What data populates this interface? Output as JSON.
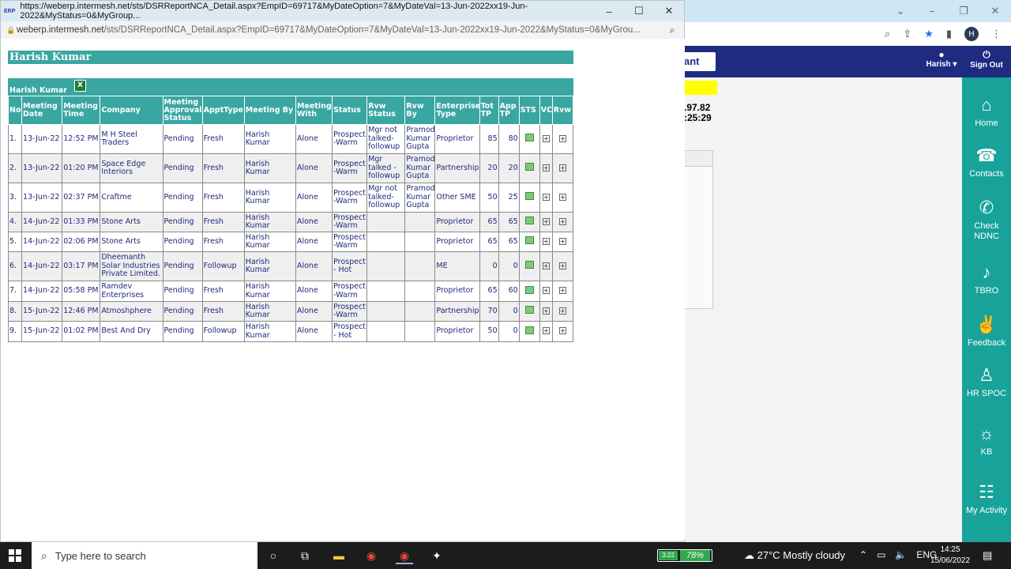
{
  "popup": {
    "title": "https://weberp.intermesh.net/sts/DSRReportNCA_Detail.aspx?EmpID=69717&MyDateOption=7&MyDateVal=13-Jun-2022xx19-Jun-2022&MyStatus=0&MyGroup...",
    "url_domain": "weberp.intermesh.net",
    "url_path": "/sts/DSRReportNCA_Detail.aspx?EmpID=69717&MyDateOption=7&MyDateVal=13-Jun-2022xx19-Jun-2022&MyStatus=0&MyGrou...",
    "logo_text": "ERP"
  },
  "report": {
    "header": "Harish Kumar",
    "subheader": "Harish Kumar",
    "columns": [
      "No",
      "Meeting Date",
      "Meeting Time",
      "Company",
      "Meeting Approval Status",
      "ApptType",
      "Meeting By",
      "Meeting With",
      "Status",
      "Rvw Status",
      "Rvw By",
      "Enterprise Type",
      "Tot TP",
      "App TP",
      "STS",
      "VC",
      "Rvw"
    ],
    "rows": [
      {
        "no": "1.",
        "date": "13-Jun-22",
        "time": "12:52 PM",
        "company": "M H Steel Traders",
        "approval": "Pending",
        "appt": "Fresh",
        "by": "Harish Kumar",
        "with": "Alone",
        "status": "Prospect -Warm",
        "rvw_status": "Mgr not talked-followup",
        "rvw_by": "Pramod Kumar Gupta",
        "ent": "Proprietor",
        "tot": "85",
        "app": "80"
      },
      {
        "no": "2.",
        "date": "13-Jun-22",
        "time": "01:20 PM",
        "company": "Space Edge Interiors",
        "approval": "Pending",
        "appt": "Fresh",
        "by": "Harish Kumar",
        "with": "Alone",
        "status": "Prospect -Warm",
        "rvw_status": "Mgr talked - followup",
        "rvw_by": "Pramod Kumar Gupta",
        "ent": "Partnership",
        "tot": "20",
        "app": "20"
      },
      {
        "no": "3.",
        "date": "13-Jun-22",
        "time": "02:37 PM",
        "company": "Craftme",
        "approval": "Pending",
        "appt": "Fresh",
        "by": "Harish Kumar",
        "with": "Alone",
        "status": "Prospect -Warm",
        "rvw_status": "Mgr not talked-followup",
        "rvw_by": "Pramod Kumar Gupta",
        "ent": "Other SME",
        "tot": "50",
        "app": "25"
      },
      {
        "no": "4.",
        "date": "14-Jun-22",
        "time": "01:33 PM",
        "company": "Stone Arts",
        "approval": "Pending",
        "appt": "Fresh",
        "by": "Harish Kumar",
        "with": "Alone",
        "status": "Prospect -Warm",
        "rvw_status": "",
        "rvw_by": "",
        "ent": "Proprietor",
        "tot": "65",
        "app": "65"
      },
      {
        "no": "5.",
        "date": "14-Jun-22",
        "time": "02:06 PM",
        "company": "Stone Arts",
        "approval": "Pending",
        "appt": "Fresh",
        "by": "Harish Kumar",
        "with": "Alone",
        "status": "Prospect -Warm",
        "rvw_status": "",
        "rvw_by": "",
        "ent": "Proprietor",
        "tot": "65",
        "app": "65"
      },
      {
        "no": "6.",
        "date": "14-Jun-22",
        "time": "03:17 PM",
        "company": "Dheemanth Solar Industries Private Limited.",
        "approval": "Pending",
        "appt": "Followup",
        "by": "Harish Kumar",
        "with": "Alone",
        "status": "Prospect - Hot",
        "rvw_status": "",
        "rvw_by": "",
        "ent": "ME",
        "tot": "0",
        "app": "0"
      },
      {
        "no": "7.",
        "date": "14-Jun-22",
        "time": "05:58 PM",
        "company": "Ramdev Enterprises",
        "approval": "Pending",
        "appt": "Fresh",
        "by": "Harish Kumar",
        "with": "Alone",
        "status": "Prospect -Warm",
        "rvw_status": "",
        "rvw_by": "",
        "ent": "Proprietor",
        "tot": "65",
        "app": "60"
      },
      {
        "no": "8.",
        "date": "15-Jun-22",
        "time": "12:46 PM",
        "company": "Atmoshphere",
        "approval": "Pending",
        "appt": "Fresh",
        "by": "Harish Kumar",
        "with": "Alone",
        "status": "Prospect -Warm",
        "rvw_status": "",
        "rvw_by": "",
        "ent": "Partnership",
        "tot": "70",
        "app": "0"
      },
      {
        "no": "9.",
        "date": "15-Jun-22",
        "time": "01:02 PM",
        "company": "Best And Dry",
        "approval": "Pending",
        "appt": "Followup",
        "by": "Harish Kumar",
        "with": "Alone",
        "status": "Prospect - Hot",
        "rvw_status": "",
        "rvw_by": "",
        "ent": "Proprietor",
        "tot": "50",
        "app": "0"
      }
    ]
  },
  "background": {
    "partial_button": "ant",
    "user_label": "Harish",
    "signout_label": "Sign Out",
    "partial_numbers": [
      ".97.82",
      ":25:29"
    ],
    "nav": [
      "Home",
      "Contacts",
      "Check NDNC",
      "TBRO",
      "Feedback",
      "HR SPOC",
      "KB",
      "My Activity"
    ],
    "avatar_letter": "H"
  },
  "taskbar": {
    "search_placeholder": "Type here to search",
    "battery_small": "3:22",
    "battery_percent": "78%",
    "weather": "27°C  Mostly cloudy",
    "language": "ENG",
    "time": "14:25",
    "date": "15/06/2022"
  }
}
